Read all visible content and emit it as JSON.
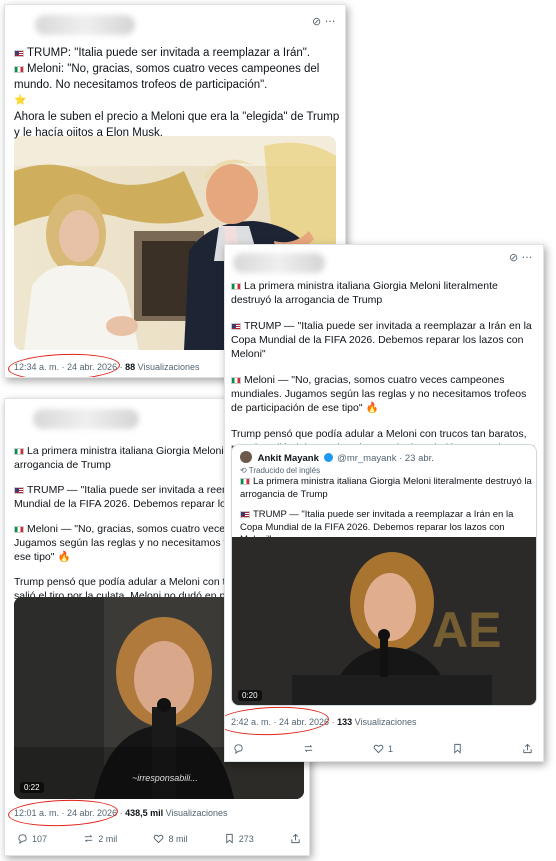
{
  "post_a": {
    "line1": "TRUMP: \"Italia puede ser invitada a reemplazar a Irán\".",
    "line2": "Meloni: \"No, gracias, somos cuatro veces campeones del mundo. No necesitamos trofeos de participación\".",
    "line3": "Ahora le suben el precio a Meloni que era la \"elegida\" de Trump y le hacía ojitos a Elon Musk.",
    "star": "⭐",
    "time": "12:34 a. m. · 24 abr. 2026 ·",
    "views_count": "88",
    "views_label": "Visualizaciones"
  },
  "post_b": {
    "p1": "La primera ministra italiana Giorgia Meloni literalmente destruyó la arrogancia de Trump",
    "p2": "TRUMP — \"Italia puede ser invitada a reemplazar a Irán en la Copa Mundial de la FIFA 2026. Debemos reparar los lazos con Meloni\"",
    "p3": "Meloni — \"No, gracias, somos cuatro veces campeones mundiales. Jugamos según las reglas y no necesitamos trofeos de participación de ese tipo\"",
    "p4": "Trump pensó que podía adular a Meloni con trucos tan baratos, pero le salió el tiro por la culata. Meloni no dudó en ponerlo en su lugar",
    "emoji_fire": "🔥",
    "emoji_face": "😏",
    "quote": {
      "name": "Ankit Mayank",
      "handle": "@mr_mayank · 23 abr.",
      "translated": "Traducido del inglés",
      "q1": "La primera ministra italiana Giorgia Meloni literalmente destruyó la arrogancia de Trump",
      "q2": "TRUMP — \"Italia puede ser invitada a reemplazar a Irán en la Copa Mundial de la FIFA 2026. Debemos reparar los lazos con Meloni\"...",
      "duration": "0:20"
    },
    "time": "2:42 a. m. · 24 abr. 2026 ·",
    "views_count": "133",
    "views_label": "Visualizaciones",
    "likes": "1"
  },
  "post_c": {
    "p1": "La primera ministra italiana Giorgia Meloni literalm",
    "p1b": "arrogancia de Trump",
    "p2": "TRUMP — \"Italia puede ser invitada a reemplazar a",
    "p2b": "Mundial de la FIFA 2026. Debemos reparar los lazos c",
    "p3": "Meloni — \"No, gracias, somos cuatro veces campe",
    "p3b": "Jugamos según las reglas y no necesitamos trofeos d",
    "p3c": "ese tipo\"",
    "p4": "Trump pensó que podía adular a Meloni con trucos ta",
    "p4b": "salió el tiro por la culata. Meloni no dudó en ponerlo e",
    "video_caption": "~irresponsabili...",
    "duration": "0:22",
    "time": "12:01 a. m. · 24 abr. 2026 ·",
    "views_count": "438,5 mil",
    "views_label": "Visualizaciones",
    "replies": "107",
    "reposts": "2 mil",
    "likes": "8 mil",
    "bookmarks": "273"
  },
  "colors": {
    "accent": "#1d9bf0",
    "circle": "#e2231a",
    "muted": "#536471"
  },
  "icons": [
    "grok-icon",
    "more-icon",
    "reply-icon",
    "repost-icon",
    "like-icon",
    "bookmark-icon",
    "share-icon",
    "verified-icon",
    "translate-icon"
  ]
}
